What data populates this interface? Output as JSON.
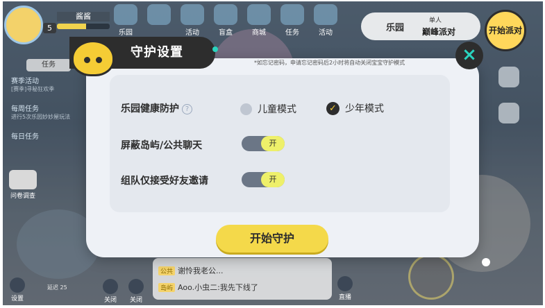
{
  "hud": {
    "player_name": "酱酱",
    "level": "5",
    "exp_fraction": 0.55,
    "nav_items": [
      {
        "label": "乐园",
        "icon": "park-icon"
      },
      {
        "label": "",
        "icon": "friends-icon"
      },
      {
        "label": "活动",
        "icon": "activity-icon"
      },
      {
        "label": "盲盒",
        "icon": "blindbox-icon"
      },
      {
        "label": "商城",
        "icon": "shop-icon"
      },
      {
        "label": "任务",
        "icon": "task-icon"
      },
      {
        "label": "活动",
        "icon": "event-icon"
      }
    ],
    "mode": {
      "current": "乐园",
      "single": "单人",
      "name": "巅峰派对"
    },
    "start_party": "开始派对"
  },
  "left_panel": {
    "task_tab": "任务",
    "tasks": [
      {
        "title": "赛季活动",
        "desc": "[赛季]寻秘狂欢季"
      },
      {
        "title": "每周任务",
        "desc": "进行5次乐园妙妙屋玩法"
      },
      {
        "title": "每日任务",
        "desc": ""
      }
    ],
    "survey": "问卷调查"
  },
  "chat": {
    "line1": {
      "tag": "公共",
      "text": "谢怜我老公..."
    },
    "line2": {
      "tag": "岛屿",
      "text": "Aoo.小虫二:我先下线了"
    }
  },
  "bottom": {
    "setting": "设置",
    "distance": "延迟 25",
    "close1": "关闭",
    "close2": "关闭",
    "live": "直播"
  },
  "dialog": {
    "title": "守护设置",
    "hint": "*如忘记密码，申请忘记密码后2小时将自动关闭宝宝守护模式",
    "close_icon": "×",
    "health_label": "乐园健康防护",
    "help_icon": "?",
    "options": {
      "child": "儿童模式",
      "teen": "少年模式",
      "selected": "少年模式"
    },
    "block_label": "屏蔽岛屿/公共聊天",
    "block_toggle": "开",
    "team_label": "组队仅接受好友邀请",
    "team_toggle": "开",
    "start_button": "开始守护"
  },
  "colors": {
    "dialog_bg": "#eef1f6",
    "header_dark": "#2d2d2d",
    "accent_yellow": "#f4d94a",
    "toggle_on": "#eef06a",
    "close_accent": "#2ad4bf"
  }
}
